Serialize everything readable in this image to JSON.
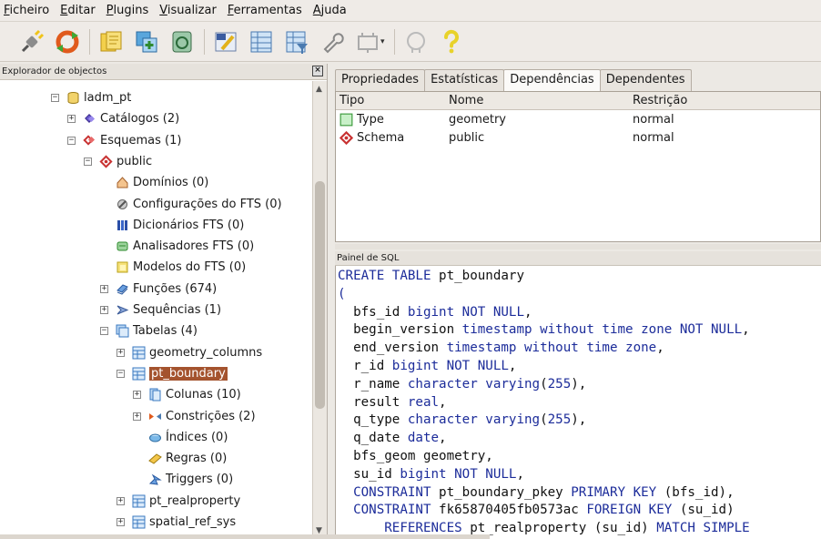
{
  "menu": [
    {
      "label": "Ficheiro"
    },
    {
      "label": "Editar"
    },
    {
      "label": "Plugins"
    },
    {
      "label": "Visualizar"
    },
    {
      "label": "Ferramentas"
    },
    {
      "label": "Ajuda"
    }
  ],
  "toolbar": {
    "icons": [
      "connect-icon",
      "refresh-icon",
      "properties-icon",
      "create-object-icon",
      "drop-object-icon",
      "sql-query-icon",
      "view-data-icon",
      "filtered-data-icon",
      "maintenance-icon",
      "plugins-icon",
      "postgres-elephant-icon",
      "help-icon"
    ]
  },
  "object_browser": {
    "title": "Explorador de objectos",
    "close_label": "×",
    "tree": [
      {
        "label": "ladm_pt",
        "level": 0,
        "icon": "database-icon",
        "expander": "−"
      },
      {
        "label": "Catálogos (2)",
        "level": 1,
        "icon": "catalogs-icon",
        "expander": "+"
      },
      {
        "label": "Esquemas (1)",
        "level": 1,
        "icon": "schemas-icon",
        "expander": "−"
      },
      {
        "label": "public",
        "level": 2,
        "icon": "schema-icon",
        "expander": "−"
      },
      {
        "label": "Domínios (0)",
        "level": 3,
        "icon": "domains-icon",
        "expander": ""
      },
      {
        "label": "Configurações do FTS (0)",
        "level": 3,
        "icon": "fts-config-icon",
        "expander": ""
      },
      {
        "label": "Dicionários FTS (0)",
        "level": 3,
        "icon": "fts-dictionary-icon",
        "expander": ""
      },
      {
        "label": "Analisadores FTS (0)",
        "level": 3,
        "icon": "fts-parser-icon",
        "expander": ""
      },
      {
        "label": "Modelos do FTS (0)",
        "level": 3,
        "icon": "fts-template-icon",
        "expander": ""
      },
      {
        "label": "Funções (674)",
        "level": 3,
        "icon": "functions-icon",
        "expander": "+"
      },
      {
        "label": "Sequências (1)",
        "level": 3,
        "icon": "sequences-icon",
        "expander": "+"
      },
      {
        "label": "Tabelas (4)",
        "level": 3,
        "icon": "tables-icon",
        "expander": "−"
      },
      {
        "label": "geometry_columns",
        "level": 4,
        "icon": "table-icon",
        "expander": "+"
      },
      {
        "label": "pt_boundary",
        "level": 4,
        "icon": "table-icon",
        "expander": "−",
        "selected": true
      },
      {
        "label": "Colunas (10)",
        "level": 5,
        "icon": "columns-icon",
        "expander": "+"
      },
      {
        "label": "Constrições (2)",
        "level": 5,
        "icon": "constraints-icon",
        "expander": "+"
      },
      {
        "label": "Índices (0)",
        "level": 5,
        "icon": "indexes-icon",
        "expander": ""
      },
      {
        "label": "Regras (0)",
        "level": 5,
        "icon": "rules-icon",
        "expander": ""
      },
      {
        "label": "Triggers (0)",
        "level": 5,
        "icon": "triggers-icon",
        "expander": ""
      },
      {
        "label": "pt_realproperty",
        "level": 4,
        "icon": "table-icon",
        "expander": "+"
      },
      {
        "label": "spatial_ref_sys",
        "level": 4,
        "icon": "table-icon",
        "expander": "+"
      }
    ]
  },
  "tabs": [
    {
      "label": "Propriedades",
      "active": false
    },
    {
      "label": "Estatísticas",
      "active": false
    },
    {
      "label": "Dependências",
      "active": true
    },
    {
      "label": "Dependentes",
      "active": false
    }
  ],
  "dependencies": {
    "headers": {
      "tipo": "Tipo",
      "nome": "Nome",
      "restricao": "Restrição"
    },
    "rows": [
      {
        "tipo": "Type",
        "nome": "geometry",
        "restricao": "normal",
        "icon": "type-icon"
      },
      {
        "tipo": "Schema",
        "nome": "public",
        "restricao": "normal",
        "icon": "schema-icon"
      }
    ]
  },
  "sql_panel": {
    "title": "Painel de SQL",
    "lines": [
      [
        {
          "t": "CREATE TABLE ",
          "k": 1
        },
        {
          "t": "pt_boundary",
          "k": 0
        }
      ],
      [
        {
          "t": "(",
          "k": 1
        }
      ],
      [
        {
          "t": "  bfs_id ",
          "k": 0
        },
        {
          "t": "bigint NOT NULL",
          "k": 1
        },
        {
          "t": ",",
          "k": 0
        }
      ],
      [
        {
          "t": "  begin_version ",
          "k": 0
        },
        {
          "t": "timestamp without time zone NOT NULL",
          "k": 1
        },
        {
          "t": ",",
          "k": 0
        }
      ],
      [
        {
          "t": "  end_version ",
          "k": 0
        },
        {
          "t": "timestamp without time zone",
          "k": 1
        },
        {
          "t": ",",
          "k": 0
        }
      ],
      [
        {
          "t": "  r_id ",
          "k": 0
        },
        {
          "t": "bigint NOT NULL",
          "k": 1
        },
        {
          "t": ",",
          "k": 0
        }
      ],
      [
        {
          "t": "  r_name ",
          "k": 0
        },
        {
          "t": "character varying",
          "k": 1
        },
        {
          "t": "(",
          "k": 0
        },
        {
          "t": "255",
          "k": 1
        },
        {
          "t": "),",
          "k": 0
        }
      ],
      [
        {
          "t": "  result ",
          "k": 0
        },
        {
          "t": "real",
          "k": 1
        },
        {
          "t": ",",
          "k": 0
        }
      ],
      [
        {
          "t": "  q_type ",
          "k": 0
        },
        {
          "t": "character varying",
          "k": 1
        },
        {
          "t": "(",
          "k": 0
        },
        {
          "t": "255",
          "k": 1
        },
        {
          "t": "),",
          "k": 0
        }
      ],
      [
        {
          "t": "  q_date ",
          "k": 0
        },
        {
          "t": "date",
          "k": 1
        },
        {
          "t": ",",
          "k": 0
        }
      ],
      [
        {
          "t": "  bfs_geom geometry,",
          "k": 0
        }
      ],
      [
        {
          "t": "  su_id ",
          "k": 0
        },
        {
          "t": "bigint NOT NULL",
          "k": 1
        },
        {
          "t": ",",
          "k": 0
        }
      ],
      [
        {
          "t": "  CONSTRAINT ",
          "k": 1
        },
        {
          "t": "pt_boundary_pkey ",
          "k": 0
        },
        {
          "t": "PRIMARY KEY ",
          "k": 1
        },
        {
          "t": "(bfs_id),",
          "k": 0
        }
      ],
      [
        {
          "t": "  CONSTRAINT ",
          "k": 1
        },
        {
          "t": "fk65870405fb0573ac ",
          "k": 0
        },
        {
          "t": "FOREIGN KEY ",
          "k": 1
        },
        {
          "t": "(su_id)",
          "k": 0
        }
      ],
      [
        {
          "t": "      REFERENCES ",
          "k": 1
        },
        {
          "t": "pt_realproperty (su_id) ",
          "k": 0
        },
        {
          "t": "MATCH SIMPLE",
          "k": 1
        }
      ]
    ]
  }
}
